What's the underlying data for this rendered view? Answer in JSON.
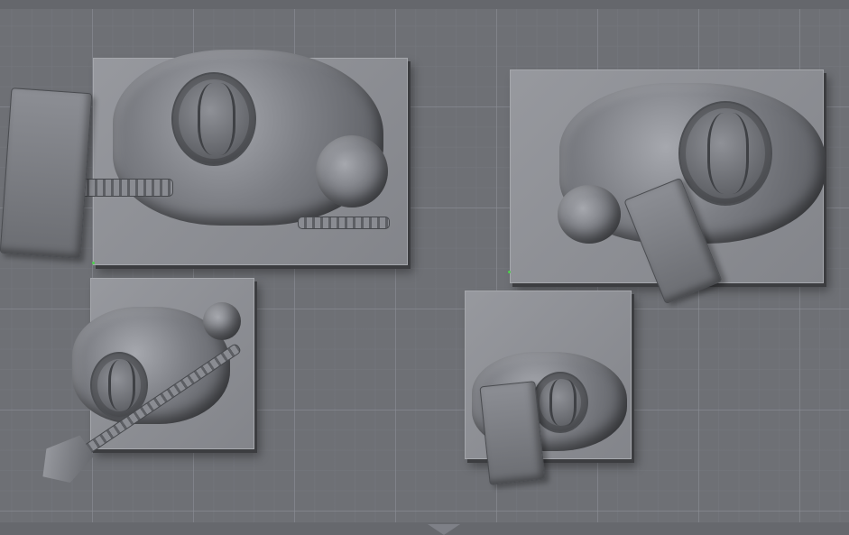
{
  "scene": {
    "title": "",
    "models": [
      {
        "id": "hammer-warrior-top-left",
        "parts": [
          "hammer",
          "body",
          "helmet",
          "base"
        ]
      },
      {
        "id": "warrior-top-right",
        "parts": [
          "body",
          "helmet",
          "shield",
          "base"
        ]
      },
      {
        "id": "axe-warrior-bottom-left",
        "parts": [
          "axe",
          "body",
          "helmet",
          "base"
        ]
      },
      {
        "id": "shield-warrior-bottom-right",
        "parts": [
          "shield",
          "body",
          "helmet",
          "base"
        ]
      }
    ]
  },
  "colors": {
    "grid_background": "#6e7075",
    "base_plate": "#8e9096",
    "model_gray": "#7c7e84",
    "support_marker": "#4cd04c"
  },
  "icons": {
    "build_plate_front_marker": "triangle-down-icon"
  }
}
